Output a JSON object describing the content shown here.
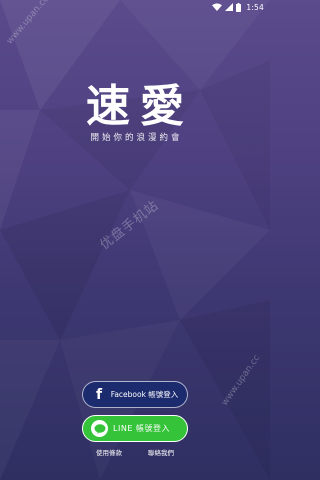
{
  "status_bar": {
    "time": "1:54"
  },
  "brand": {
    "title": "速愛",
    "tagline": "開始你的浪漫約會"
  },
  "watermarks": {
    "top": "www.upan.cc",
    "middle": "优盘手机站",
    "right": "www.upan.cc"
  },
  "login": {
    "facebook_label": "Facebook 帳號登入",
    "line_label": "LINE 帳號登入",
    "facebook_icon_glyph": "f"
  },
  "footer": {
    "terms": "使用條款",
    "contact": "聯絡我們"
  },
  "colors": {
    "facebook_bg": "#1c2a6e",
    "line_green": "#35c33a",
    "background_top": "#5b4a8c",
    "background_bottom": "#2f2f62"
  },
  "icons": [
    "wifi-icon",
    "signal-icon",
    "battery-icon",
    "facebook-icon",
    "line-icon"
  ]
}
